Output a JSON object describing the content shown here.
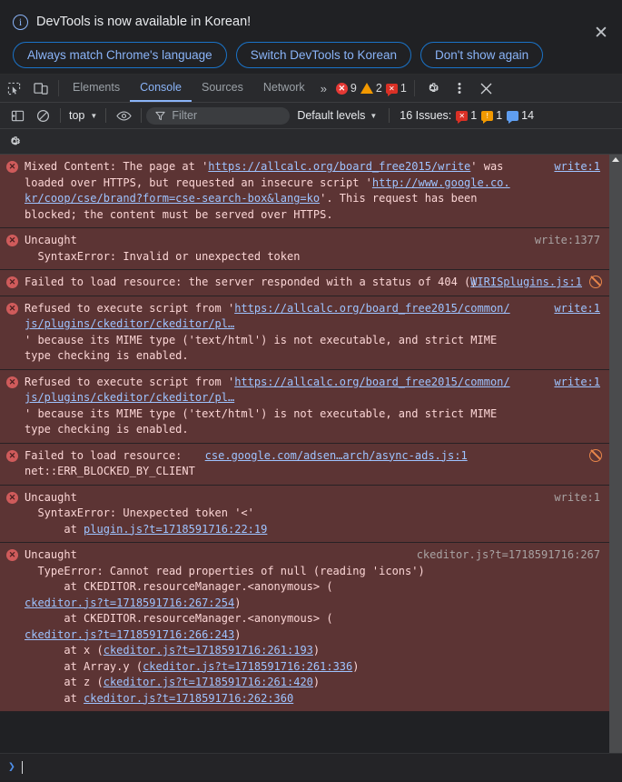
{
  "banner": {
    "icon": "info-icon",
    "message": "DevTools is now available in Korean!",
    "buttons": [
      {
        "label": "Always match Chrome's language"
      },
      {
        "label": "Switch DevTools to Korean"
      },
      {
        "label": "Don't show again"
      }
    ],
    "close_label": "✕"
  },
  "tabbar": {
    "inspect_icon": "inspect-element-icon",
    "device_icon": "device-toolbar-icon",
    "tabs": [
      {
        "label": "Elements",
        "active": false
      },
      {
        "label": "Console",
        "active": true
      },
      {
        "label": "Sources",
        "active": false
      },
      {
        "label": "Network",
        "active": false
      }
    ],
    "more_tabs_label": "»",
    "error_count": "9",
    "warning_count": "2",
    "issue_count": "1",
    "error_glyph": "✕",
    "issue_glyph": "✕",
    "settings_icon": "gear-icon",
    "menu_icon": "kebab-menu-icon",
    "close_icon": "close-icon"
  },
  "filterbar": {
    "sidebar_icon": "show-console-sidebar-icon",
    "clear_icon": "clear-console-icon",
    "context": "top",
    "caret": "▼",
    "eye_icon": "live-expression-eye-icon",
    "filter_icon": "filter-funnel-icon",
    "filter_placeholder": "Filter",
    "filter_value": "",
    "levels_label": "Default levels",
    "issues_label": "16 Issues:",
    "issue_badges": [
      {
        "kind": "error",
        "glyph": "✕",
        "count": "1",
        "color": "#d93025"
      },
      {
        "kind": "warning",
        "glyph": "!",
        "count": "1",
        "color": "#f29900"
      },
      {
        "kind": "info",
        "glyph": "",
        "count": "14",
        "color": "#5f9ef0"
      }
    ]
  },
  "settings_strip": {
    "gear_icon": "console-settings-gear-icon"
  },
  "messages": [
    {
      "id": "mixed-content",
      "level": "error",
      "source": "write:1",
      "source_link": true,
      "blocked_icon": false,
      "parts": [
        {
          "t": "text",
          "v": "Mixed Content: The page at '"
        },
        {
          "t": "link",
          "v": "https://allcalc.org/board_free2015/write"
        },
        {
          "t": "text",
          "v": "' was loaded over HTTPS, but requested an insecure script '"
        },
        {
          "t": "link",
          "v": "http://www.google.co.kr/coop/cse/brand?form=cse-search-box&lang=ko"
        },
        {
          "t": "text",
          "v": "'. This request has been blocked; the content must be served over HTTPS."
        }
      ]
    },
    {
      "id": "uncaught-syntax-invalid",
      "level": "error",
      "source": "write:1377",
      "source_link": false,
      "blocked_icon": false,
      "parts": [
        {
          "t": "text",
          "v": "Uncaught\n  SyntaxError: Invalid or unexpected token"
        }
      ]
    },
    {
      "id": "failed-404-wiris",
      "level": "error",
      "source": "WIRISplugins.js:1",
      "source_link": true,
      "blocked_icon": true,
      "parts": [
        {
          "t": "text",
          "v": "Failed to load resource: the server responded with a status of 404 ()"
        }
      ]
    },
    {
      "id": "refused-mime-1",
      "level": "error",
      "source": "write:1",
      "source_link": true,
      "blocked_icon": false,
      "parts": [
        {
          "t": "text",
          "v": "Refused to execute script from '"
        },
        {
          "t": "link",
          "v": "https://allcalc.org/board_free2015/common/js/plugins/ckeditor/ckeditor/pl…"
        },
        {
          "t": "text",
          "v": "\n' because its MIME type ('text/html') is not executable, and strict MIME type checking is enabled."
        }
      ]
    },
    {
      "id": "refused-mime-2",
      "level": "error",
      "source": "write:1",
      "source_link": true,
      "blocked_icon": false,
      "parts": [
        {
          "t": "text",
          "v": "Refused to execute script from '"
        },
        {
          "t": "link",
          "v": "https://allcalc.org/board_free2015/common/js/plugins/ckeditor/ckeditor/pl…"
        },
        {
          "t": "text",
          "v": "\n' because its MIME type ('text/html') is not executable, and strict MIME type checking is enabled."
        }
      ]
    },
    {
      "id": "blocked-by-client",
      "level": "error",
      "source": "cse.google.com/adsen…arch/async-ads.js:1",
      "source_link": true,
      "source_position": "middle",
      "blocked_icon": true,
      "parts": [
        {
          "t": "text",
          "v": "Failed to load resource:\nnet::ERR_BLOCKED_BY_CLIENT"
        }
      ]
    },
    {
      "id": "uncaught-unexpected-token",
      "level": "error",
      "source": "write:1",
      "source_link": false,
      "blocked_icon": false,
      "parts": [
        {
          "t": "text",
          "v": "Uncaught\n  SyntaxError: Unexpected token '<'\n      at "
        },
        {
          "t": "link",
          "v": "plugin.js?t=1718591716:22:19"
        }
      ]
    },
    {
      "id": "uncaught-typeerror-icons",
      "level": "error",
      "source": "ckeditor.js?t=1718591716:267",
      "source_link": false,
      "blocked_icon": false,
      "parts": [
        {
          "t": "text",
          "v": "Uncaught\n  TypeError: Cannot read properties of null (reading 'icons')\n      at CKEDITOR.resourceManager.<anonymous> (\n"
        },
        {
          "t": "link",
          "v": "ckeditor.js?t=1718591716:267:254"
        },
        {
          "t": "text",
          "v": ")\n      at CKEDITOR.resourceManager.<anonymous> (\n"
        },
        {
          "t": "link",
          "v": "ckeditor.js?t=1718591716:266:243"
        },
        {
          "t": "text",
          "v": ")\n      at x ("
        },
        {
          "t": "link",
          "v": "ckeditor.js?t=1718591716:261:193"
        },
        {
          "t": "text",
          "v": ")\n      at Array.y ("
        },
        {
          "t": "link",
          "v": "ckeditor.js?t=1718591716:261:336"
        },
        {
          "t": "text",
          "v": ")\n      at z ("
        },
        {
          "t": "link",
          "v": "ckeditor.js?t=1718591716:261:420"
        },
        {
          "t": "text",
          "v": ")\n      at "
        },
        {
          "t": "link",
          "v": "ckeditor.js?t=1718591716:262:360"
        }
      ]
    }
  ],
  "prompt": {
    "chevron": "❯",
    "value": ""
  },
  "scrollbar": {
    "up_arrow": "scroll-up-arrow"
  }
}
